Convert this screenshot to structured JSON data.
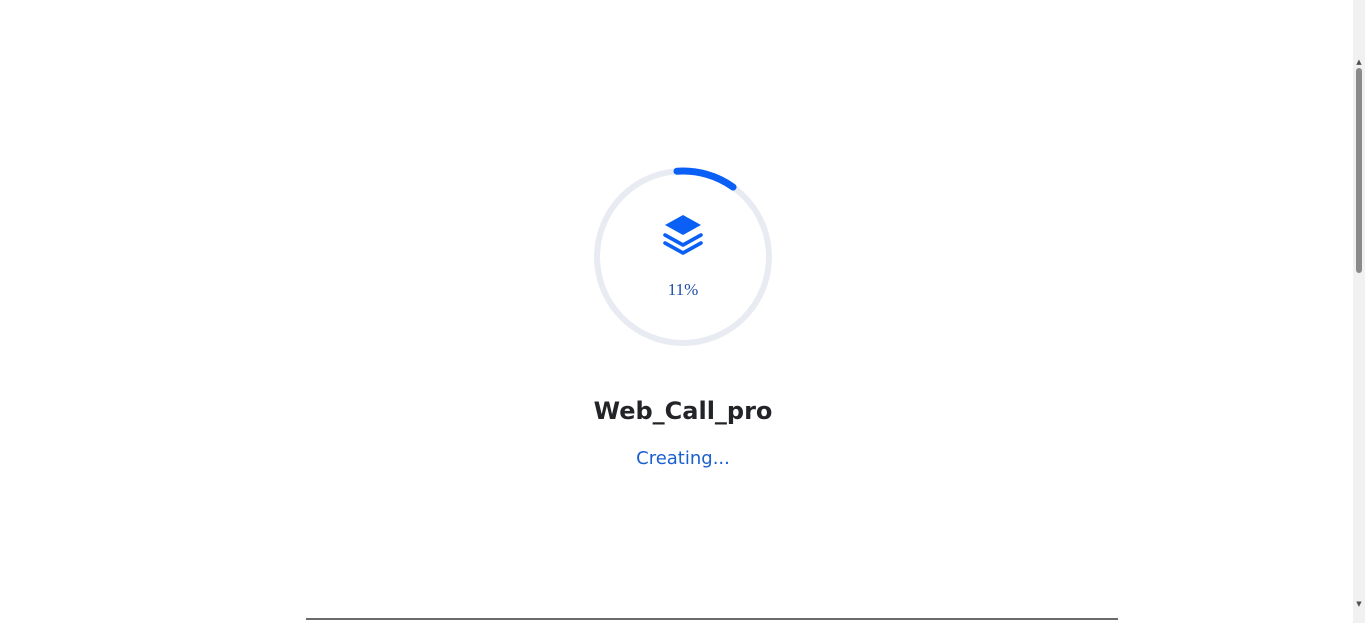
{
  "loader": {
    "progress_percent": 11,
    "percent_label": "11%",
    "icon": "layers-icon",
    "track_color": "#e8ebf2",
    "progress_color": "#0a5ff5"
  },
  "project": {
    "name": "Web_Call_pro",
    "status": "Creating..."
  },
  "scrollbar": {
    "up_icon": "triangle-up-icon",
    "down_icon": "triangle-down-icon"
  }
}
